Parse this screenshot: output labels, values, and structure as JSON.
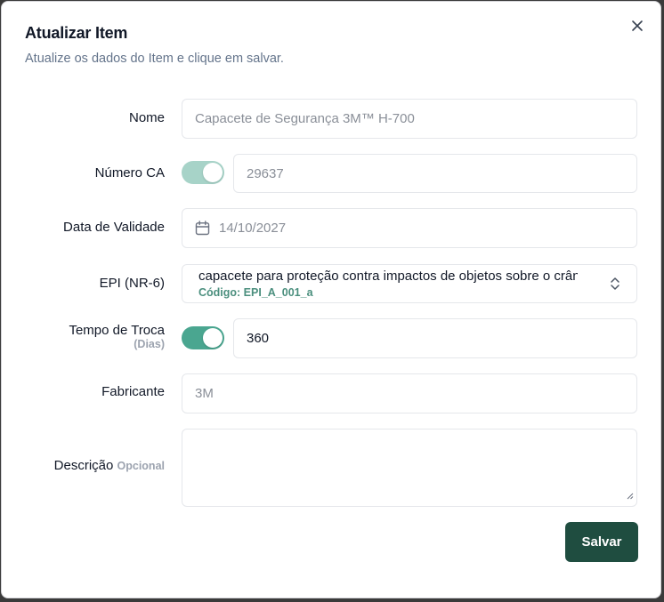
{
  "dialog": {
    "title": "Atualizar Item",
    "subtitle": "Atualize os dados do Item e clique em salvar.",
    "close_icon": "close-icon"
  },
  "form": {
    "nome": {
      "label": "Nome",
      "placeholder": "Capacete de Segurança 3M™ H-700"
    },
    "numero_ca": {
      "label": "Número CA",
      "toggle_on": true,
      "toggle_disabled": true,
      "value": "29637"
    },
    "data_validade": {
      "label": "Data de Validade",
      "icon": "calendar-icon",
      "value": "14/10/2027"
    },
    "epi": {
      "label": "EPI (NR-6)",
      "selected": "capacete para proteção contra impactos de objetos sobre o crânio",
      "code": "Código: EPI_A_001_a",
      "icon": "chevron-up-down-icon"
    },
    "tempo_troca": {
      "label": "Tempo de Troca",
      "sublabel": "(Dias)",
      "toggle_on": true,
      "value": "360"
    },
    "fabricante": {
      "label": "Fabricante",
      "value": "3M"
    },
    "descricao": {
      "label": "Descrição",
      "optional": "Opcional",
      "value": ""
    }
  },
  "actions": {
    "save_label": "Salvar"
  },
  "colors": {
    "primary": "#1f4d40",
    "toggle_on": "#4aa690",
    "toggle_disabled": "#a7d3c8",
    "muted_text": "#64748b"
  }
}
